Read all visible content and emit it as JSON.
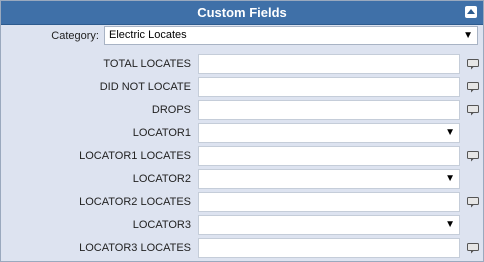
{
  "panel": {
    "title": "Custom Fields"
  },
  "category": {
    "label": "Category:",
    "value": "Electric Locates"
  },
  "fields": [
    {
      "label": "TOTAL LOCATES",
      "type": "text",
      "value": ""
    },
    {
      "label": "DID NOT LOCATE",
      "type": "text",
      "value": ""
    },
    {
      "label": "DROPS",
      "type": "text",
      "value": ""
    },
    {
      "label": "LOCATOR1",
      "type": "select",
      "value": ""
    },
    {
      "label": "LOCATOR1 LOCATES",
      "type": "text",
      "value": ""
    },
    {
      "label": "LOCATOR2",
      "type": "select",
      "value": ""
    },
    {
      "label": "LOCATOR2 LOCATES",
      "type": "text",
      "value": ""
    },
    {
      "label": "LOCATOR3",
      "type": "select",
      "value": ""
    },
    {
      "label": "LOCATOR3 LOCATES",
      "type": "text",
      "value": ""
    }
  ],
  "dropdown_arrow": "▼",
  "icons": {
    "collapse": "collapse-up-icon",
    "comment": "comment-icon"
  }
}
